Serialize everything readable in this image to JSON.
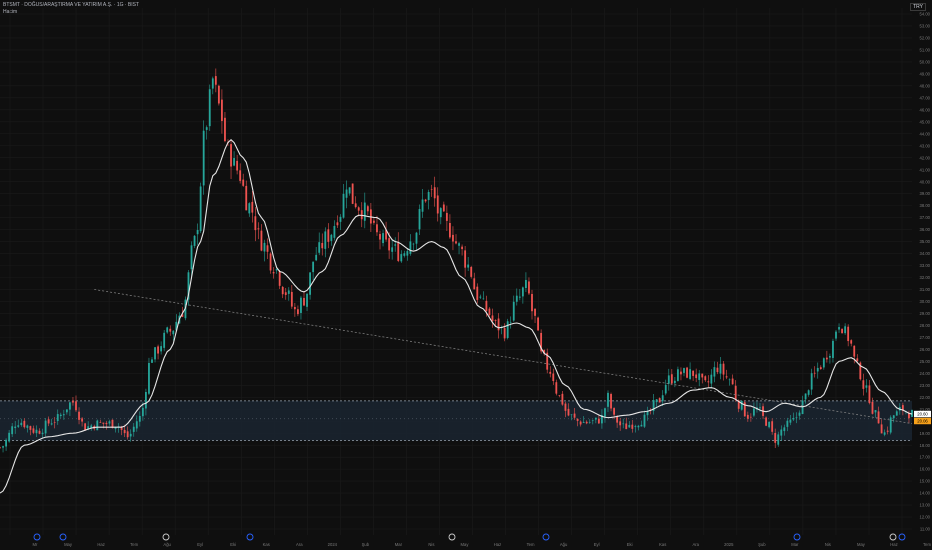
{
  "header": {
    "title": "BTSMT · DOĞUS/ARAŞTIRMA VE YATIRIM A.Ş. · 1G · BIST",
    "subtitle": "Hacim"
  },
  "currency": "TRY",
  "colors": {
    "background": "#0f0f0f",
    "grid": "#1b1b1b",
    "candle_up": "#26a69a",
    "candle_down": "#ef5350",
    "ma_line": "#e6e6e6",
    "trendline": "#8a8a8a",
    "zone_fill": "#1a2530",
    "zone_border": "#9aa6b3",
    "price_tag": "#f7a11a",
    "axis_text": "#7a7a7a",
    "event_marker": "#2962ff"
  },
  "chart_data": {
    "type": "candlestick",
    "title": "",
    "ylim": [
      10.5,
      54.5
    ],
    "y_ticks": [
      "54.00",
      "53.00",
      "52.00",
      "51.00",
      "50.00",
      "49.00",
      "48.00",
      "47.00",
      "46.00",
      "45.00",
      "44.00",
      "43.00",
      "42.00",
      "41.00",
      "40.00",
      "39.00",
      "38.00",
      "37.00",
      "36.00",
      "35.00",
      "34.00",
      "33.00",
      "32.00",
      "31.00",
      "30.00",
      "29.00",
      "28.00",
      "27.00",
      "26.00",
      "25.00",
      "24.00",
      "23.00",
      "22.00",
      "21.00",
      "20.00",
      "19.00",
      "18.00",
      "17.00",
      "16.00",
      "15.00",
      "14.00",
      "13.00",
      "12.00",
      "11.00"
    ],
    "x_labels": [
      "Mr",
      "May",
      "Haz",
      "Tem",
      "Ağu",
      "Eyl",
      "Eki",
      "Kas",
      "Ara",
      "2024",
      "Şub",
      "Mar",
      "Nis",
      "May",
      "Haz",
      "Tem",
      "Ağu",
      "Eyl",
      "Eki",
      "Kas",
      "Ara",
      "2025",
      "Şub",
      "Mar",
      "Nis",
      "May",
      "Haz",
      "Tem"
    ],
    "price_anchors": [
      [
        0,
        17.8
      ],
      [
        6,
        20.0
      ],
      [
        12,
        19.2
      ],
      [
        18,
        20.1
      ],
      [
        24,
        21.6
      ],
      [
        28,
        19.5
      ],
      [
        32,
        19.8
      ],
      [
        38,
        19.8
      ],
      [
        42,
        18.7
      ],
      [
        46,
        20.3
      ],
      [
        50,
        25.5
      ],
      [
        56,
        27.5
      ],
      [
        60,
        29.2
      ],
      [
        64,
        35.0
      ],
      [
        68,
        45.0
      ],
      [
        70,
        48.5
      ],
      [
        72,
        46.3
      ],
      [
        75,
        42.5
      ],
      [
        78,
        41.0
      ],
      [
        82,
        38.0
      ],
      [
        86,
        35.0
      ],
      [
        90,
        33.0
      ],
      [
        94,
        30.8
      ],
      [
        97,
        29.2
      ],
      [
        100,
        30.2
      ],
      [
        104,
        34.0
      ],
      [
        108,
        35.5
      ],
      [
        112,
        37.5
      ],
      [
        114,
        40.0
      ],
      [
        116,
        38.5
      ],
      [
        120,
        37.5
      ],
      [
        124,
        35.5
      ],
      [
        128,
        34.5
      ],
      [
        132,
        34.0
      ],
      [
        136,
        35.5
      ],
      [
        140,
        38.8
      ],
      [
        142,
        39.0
      ],
      [
        145,
        37.0
      ],
      [
        148,
        36.0
      ],
      [
        151,
        34.5
      ],
      [
        154,
        33.0
      ],
      [
        157,
        30.5
      ],
      [
        160,
        29.3
      ],
      [
        163,
        28.0
      ],
      [
        166,
        27.5
      ],
      [
        170,
        30.0
      ],
      [
        173,
        31.2
      ],
      [
        176,
        28.5
      ],
      [
        178,
        25.5
      ],
      [
        181,
        24.2
      ],
      [
        184,
        22.0
      ],
      [
        187,
        20.5
      ],
      [
        190,
        20.0
      ],
      [
        193,
        19.9
      ],
      [
        196,
        20.0
      ],
      [
        198,
        20.3
      ],
      [
        200,
        22.0
      ],
      [
        202,
        20.2
      ],
      [
        205,
        19.5
      ],
      [
        208,
        19.8
      ],
      [
        212,
        20.2
      ],
      [
        216,
        21.5
      ],
      [
        220,
        23.5
      ],
      [
        224,
        24.0
      ],
      [
        228,
        24.0
      ],
      [
        232,
        23.0
      ],
      [
        236,
        24.5
      ],
      [
        240,
        23.5
      ],
      [
        243,
        21.5
      ],
      [
        246,
        20.5
      ],
      [
        249,
        21.0
      ],
      [
        252,
        20.0
      ],
      [
        255,
        18.5
      ],
      [
        258,
        19.5
      ],
      [
        261,
        20.0
      ],
      [
        264,
        21.5
      ],
      [
        267,
        23.5
      ],
      [
        270,
        24.7
      ],
      [
        273,
        26.0
      ],
      [
        276,
        28.3
      ],
      [
        279,
        27.0
      ],
      [
        282,
        24.5
      ],
      [
        285,
        22.5
      ],
      [
        288,
        20.5
      ],
      [
        291,
        19.0
      ],
      [
        294,
        20.5
      ],
      [
        297,
        21.0
      ],
      [
        300,
        20.6
      ]
    ],
    "moving_average_anchors": [
      [
        0,
        14.0
      ],
      [
        8,
        18.0
      ],
      [
        16,
        18.7
      ],
      [
        24,
        19.0
      ],
      [
        32,
        19.5
      ],
      [
        40,
        19.5
      ],
      [
        48,
        21.5
      ],
      [
        56,
        26.0
      ],
      [
        60,
        29.0
      ],
      [
        66,
        35.0
      ],
      [
        70,
        40.5
      ],
      [
        76,
        43.5
      ],
      [
        80,
        42.0
      ],
      [
        86,
        37.0
      ],
      [
        92,
        32.5
      ],
      [
        100,
        30.8
      ],
      [
        106,
        32.5
      ],
      [
        112,
        35.5
      ],
      [
        118,
        37.2
      ],
      [
        124,
        37.0
      ],
      [
        130,
        35.0
      ],
      [
        136,
        34.2
      ],
      [
        142,
        35.0
      ],
      [
        146,
        34.5
      ],
      [
        152,
        32.0
      ],
      [
        158,
        29.5
      ],
      [
        164,
        27.8
      ],
      [
        170,
        28.2
      ],
      [
        174,
        27.8
      ],
      [
        180,
        25.5
      ],
      [
        186,
        23.0
      ],
      [
        192,
        21.0
      ],
      [
        200,
        20.3
      ],
      [
        206,
        20.5
      ],
      [
        212,
        20.8
      ],
      [
        220,
        21.5
      ],
      [
        228,
        22.6
      ],
      [
        234,
        22.8
      ],
      [
        240,
        22.0
      ],
      [
        246,
        21.3
      ],
      [
        252,
        20.8
      ],
      [
        258,
        21.5
      ],
      [
        264,
        21.2
      ],
      [
        270,
        22.0
      ],
      [
        276,
        25.0
      ],
      [
        280,
        25.3
      ],
      [
        284,
        24.5
      ],
      [
        290,
        22.5
      ],
      [
        296,
        21.0
      ],
      [
        300,
        20.6
      ]
    ],
    "trendline": {
      "from": [
        31,
        31.0
      ],
      "to": [
        300,
        19.8
      ]
    },
    "support_zone": {
      "top": 21.7,
      "bottom": 18.4,
      "mid": 20.2
    },
    "last_price": "20.60",
    "last_price_tag": "20.06"
  }
}
